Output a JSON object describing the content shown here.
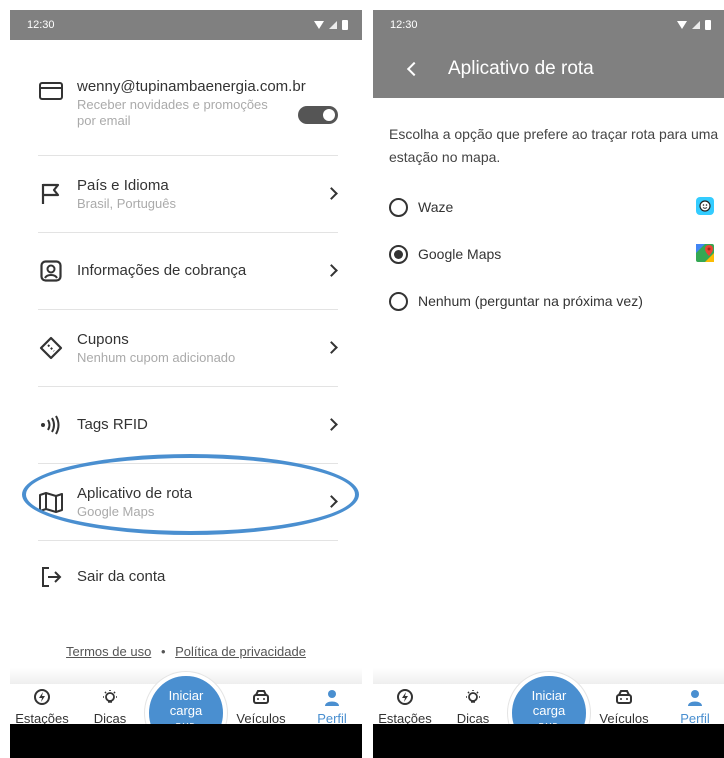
{
  "left": {
    "status_time": "12:30",
    "email_row": {
      "title": "wenny@tupinambaenergia.com.br",
      "subtitle": "Receber novidades e promoções por email",
      "toggle_on": true
    },
    "rows": [
      {
        "title": "País e Idioma",
        "subtitle": "Brasil, Português",
        "icon": "flag-icon"
      },
      {
        "title": "Informações de cobrança",
        "subtitle": "",
        "icon": "user-card-icon"
      },
      {
        "title": "Cupons",
        "subtitle": "Nenhum cupom adicionado",
        "icon": "ticket-icon"
      },
      {
        "title": "Tags RFID",
        "subtitle": "",
        "icon": "rfid-icon"
      },
      {
        "title": "Aplicativo de rota",
        "subtitle": "Google Maps",
        "icon": "map-icon"
      }
    ],
    "logout": "Sair da conta",
    "legal": {
      "terms": "Termos de uso",
      "sep": "•",
      "privacy": "Política de privacidade"
    }
  },
  "nav": {
    "items": [
      "Estações",
      "Dicas",
      "Veículos",
      "Perfil"
    ],
    "fab_line1": "Iniciar",
    "fab_line2": "carga",
    "fab_logo": "BYD",
    "active": "Perfil",
    "accent": "#4a8fd0"
  },
  "right": {
    "status_time": "12:30",
    "title": "Aplicativo de rota",
    "description": "Escolha a opção que prefere ao traçar rota para uma estação no mapa.",
    "options": [
      {
        "label": "Waze",
        "selected": false,
        "logo": "waze-logo-icon"
      },
      {
        "label": "Google Maps",
        "selected": true,
        "logo": "google-maps-logo-icon"
      },
      {
        "label": "Nenhum (perguntar na próxima vez)",
        "selected": false,
        "logo": ""
      }
    ]
  }
}
